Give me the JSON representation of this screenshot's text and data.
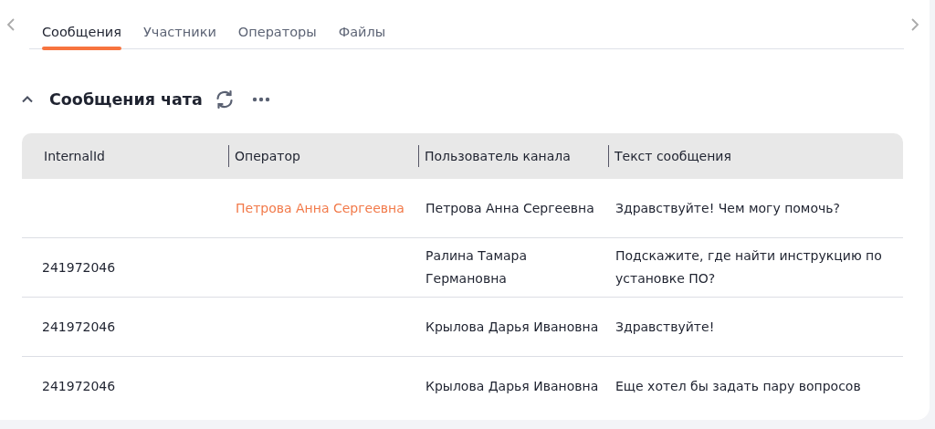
{
  "tabs": [
    {
      "label": "Сообщения",
      "selected": true
    },
    {
      "label": "Участники",
      "selected": false
    },
    {
      "label": "Операторы",
      "selected": false
    },
    {
      "label": "Файлы",
      "selected": false
    }
  ],
  "section": {
    "title": "Сообщения чата",
    "expanded": true
  },
  "table": {
    "columns": [
      "InternalId",
      "Оператор",
      "Пользователь канала",
      "Текст сообщения"
    ],
    "rows": [
      {
        "internal_id": "",
        "operator": "Петрова Анна Сергеевна",
        "channel_user": "Петрова Анна Сергеевна",
        "message": "Здравствуйте! Чем могу помочь?"
      },
      {
        "internal_id": "241972046",
        "operator": "",
        "channel_user": "Ралина Тамара Германовна",
        "message": "Подскажите, где найти инструкцию по установке ПО?"
      },
      {
        "internal_id": "241972046",
        "operator": "",
        "channel_user": "Крылова Дарья Ивановна",
        "message": "Здравствуйте!"
      },
      {
        "internal_id": "241972046",
        "operator": "",
        "channel_user": "Крылова Дарья Ивановна",
        "message": "Еще хотел бы задать пару вопросов"
      }
    ]
  }
}
